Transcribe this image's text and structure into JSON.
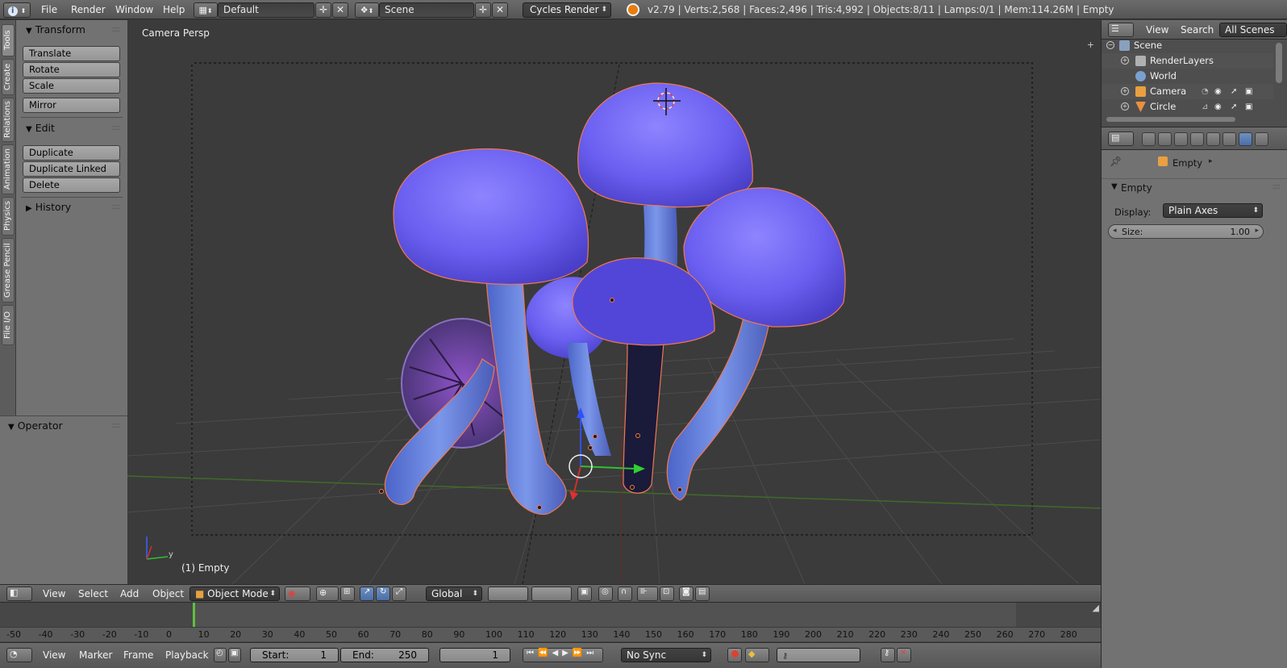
{
  "info_bar": {
    "menus": [
      "File",
      "Render",
      "Window",
      "Help"
    ],
    "layout": "Default",
    "scene": "Scene",
    "render_engine": "Cycles Render",
    "stats": "v2.79 | Verts:2,568 | Faces:2,496 | Tris:4,992 | Objects:8/11 | Lamps:0/1 | Mem:114.26M | Empty"
  },
  "tool_tabs": [
    "Tools",
    "Create",
    "Relations",
    "Animation",
    "Physics",
    "Grease Pencil",
    "File I/O"
  ],
  "tool_shelf": {
    "transform": {
      "title": "Transform",
      "buttons": [
        "Translate",
        "Rotate",
        "Scale"
      ],
      "mirror": "Mirror"
    },
    "edit": {
      "title": "Edit",
      "buttons": [
        "Duplicate",
        "Duplicate Linked",
        "Delete"
      ]
    },
    "history": {
      "title": "History"
    },
    "operator": {
      "title": "Operator"
    }
  },
  "viewport": {
    "view_name": "Camera Persp",
    "active_object": "(1) Empty",
    "axis_y": "y"
  },
  "view3d_header": {
    "menus": [
      "View",
      "Select",
      "Add",
      "Object"
    ],
    "mode": "Object Mode",
    "orientation": "Global"
  },
  "timeline": {
    "ruler": [
      "-50",
      "-40",
      "-30",
      "-20",
      "-10",
      "0",
      "10",
      "20",
      "30",
      "40",
      "50",
      "60",
      "70",
      "80",
      "90",
      "100",
      "110",
      "120",
      "130",
      "140",
      "150",
      "160",
      "170",
      "180",
      "190",
      "200",
      "210",
      "220",
      "230",
      "240",
      "250",
      "260",
      "270",
      "280"
    ],
    "menus": [
      "View",
      "Marker",
      "Frame",
      "Playback"
    ],
    "start_label": "Start:",
    "start": "1",
    "end_label": "End:",
    "end": "250",
    "current": "1",
    "sync": "No Sync"
  },
  "outliner": {
    "menus": [
      "View",
      "Search"
    ],
    "filter": "All Scenes",
    "rows": [
      {
        "label": "Scene",
        "icon_color": "#8aa0c0"
      },
      {
        "label": "RenderLayers",
        "icon_color": "#b0b0b0"
      },
      {
        "label": "World",
        "icon_color": "#7aa0d0"
      },
      {
        "label": "Camera",
        "icon_color": "#e8a040"
      },
      {
        "label": "Circle",
        "icon_color": "#e89040"
      }
    ]
  },
  "properties": {
    "breadcrumb": "Empty",
    "panel_title": "Empty",
    "display_label": "Display:",
    "display_value": "Plain Axes",
    "size_label": "Size:",
    "size_value": "1.00"
  },
  "colors": {
    "accent_blue": "#5680c2",
    "viewport_bg": "#3b3b3b",
    "panel_bg": "#727272",
    "selection_outline": "#f07850",
    "mushroom_cap": "#7a6cf0",
    "mushroom_stem": "#6a88e0"
  }
}
